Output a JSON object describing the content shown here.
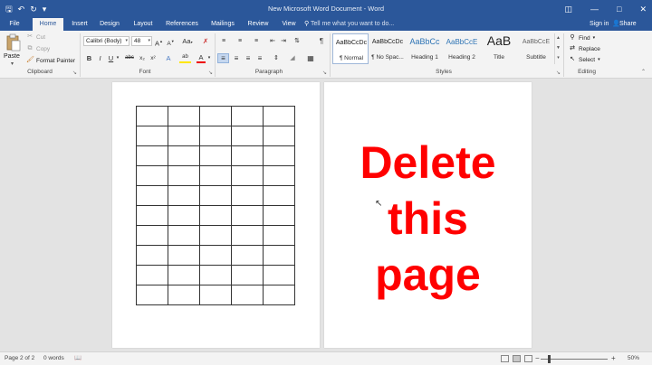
{
  "titlebar": {
    "title": "New Microsoft Word Document - Word",
    "qat_icons": [
      "save-icon",
      "undo-icon",
      "redo-icon",
      "customize-icon"
    ],
    "window_controls": [
      "restore-ribbon-icon",
      "minimize-icon",
      "maximize-icon",
      "close-icon"
    ]
  },
  "tabs": {
    "items": [
      "File",
      "Home",
      "Insert",
      "Design",
      "Layout",
      "References",
      "Mailings",
      "Review",
      "View"
    ],
    "active": "Home",
    "tell_me": "Tell me what you want to do...",
    "sign_in": "Sign in",
    "share": "Share"
  },
  "clipboard": {
    "paste": "Paste",
    "cut": "Cut",
    "copy": "Copy",
    "format_painter": "Format Painter",
    "label": "Clipboard"
  },
  "font": {
    "family": "Calibri (Body)",
    "size": "48",
    "grow": "A",
    "shrink": "A",
    "case": "Aa",
    "bold": "B",
    "italic": "I",
    "underline": "U",
    "strike": "abc",
    "subscript": "x₂",
    "superscript": "x²",
    "text_effects": "A",
    "highlight": "ab",
    "font_color": "A",
    "label": "Font"
  },
  "paragraph": {
    "label": "Paragraph",
    "pilcrow": "¶"
  },
  "styles": {
    "label": "Styles",
    "items": [
      {
        "sample": "AaBbCcDc",
        "name": "¶ Normal"
      },
      {
        "sample": "AaBbCcDc",
        "name": "¶ No Spac..."
      },
      {
        "sample": "AaBbCc",
        "name": "Heading 1"
      },
      {
        "sample": "AaBbCcE",
        "name": "Heading 2"
      },
      {
        "sample": "AaB",
        "name": "Title"
      },
      {
        "sample": "AaBbCcE",
        "name": "Subtitle"
      }
    ]
  },
  "editing": {
    "find": "Find",
    "replace": "Replace",
    "select": "Select",
    "label": "Editing"
  },
  "document": {
    "table_rows": 10,
    "table_cols": 5,
    "page2_text": [
      "Delete",
      "this",
      "page"
    ]
  },
  "status": {
    "page": "Page 2 of 2",
    "words": "0 words",
    "zoom": "50%"
  },
  "colors": {
    "accent": "#2b579a",
    "ribbon": "#f3f3f3",
    "canvas": "#e3e3e3",
    "big_text": "#ff0000"
  }
}
